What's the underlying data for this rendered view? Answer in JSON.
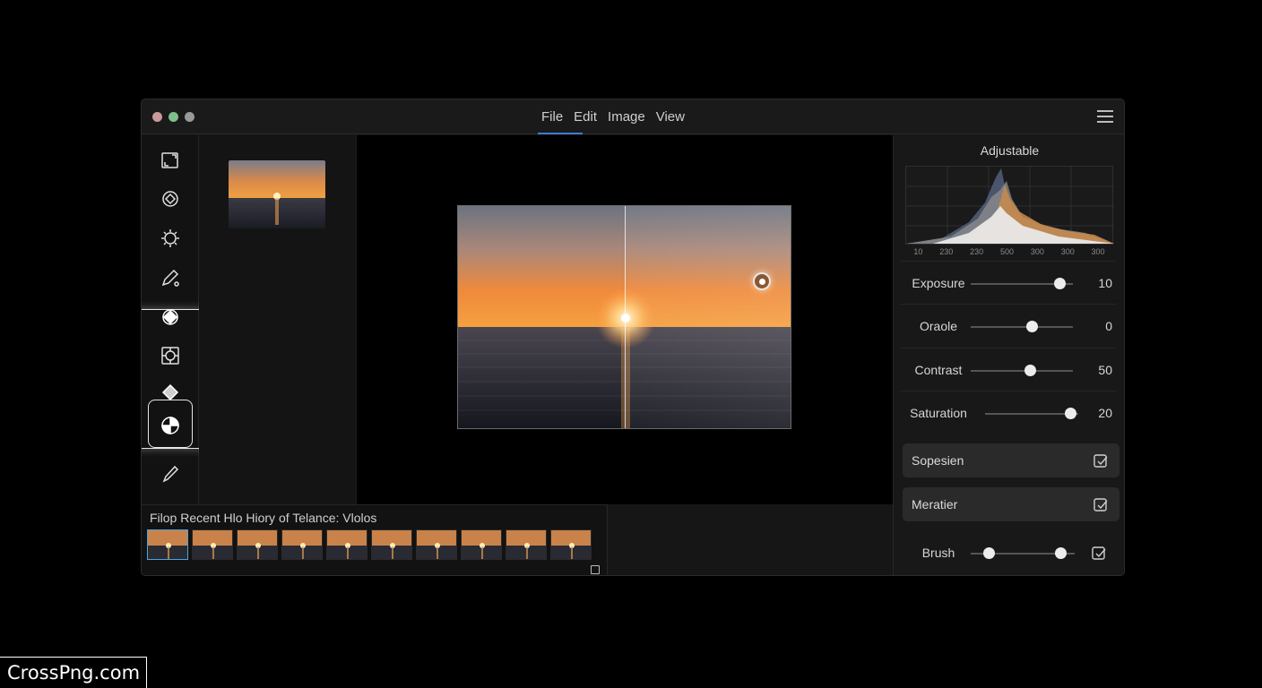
{
  "window": {
    "menu": [
      "File",
      "Edit",
      "Image",
      "View"
    ],
    "traffic_colors": [
      "#c89a9a",
      "#7fbf8e",
      "#9a9a9a"
    ]
  },
  "toolbar": {
    "tools": [
      "crop-icon",
      "rotate-icon",
      "light-icon",
      "pencil-icon",
      "diamond-fill-icon",
      "focus-icon",
      "layers-icon",
      "contrast-icon",
      "brush-icon"
    ],
    "active_tool": "contrast-icon"
  },
  "filmstrip": {
    "title": "Filop Recent Hlo Hiory of Telance: Vlolos",
    "frame_count": 10,
    "selected_index": 0
  },
  "panel": {
    "title": "Adjustable",
    "histogram_labels": [
      "10",
      "230",
      "230",
      "500",
      "300",
      "300",
      "300"
    ],
    "sliders": [
      {
        "label": "Exposure",
        "value": "10",
        "position": 0.87
      },
      {
        "label": "Oraole",
        "value": "0",
        "position": 0.6
      },
      {
        "label": "Contrast",
        "value": "50",
        "position": 0.58
      },
      {
        "label": "Saturation",
        "value": "20",
        "position": 0.91
      }
    ],
    "buttons": [
      {
        "label": "Sopesien",
        "icon": "export-icon"
      },
      {
        "label": "Meratier",
        "icon": "export-icon"
      }
    ],
    "brush": {
      "label": "Brush",
      "range": [
        0.17,
        0.86
      ],
      "icon": "export-icon"
    }
  },
  "watermark": "CrossPng.com",
  "accent": "#3a7bd5"
}
